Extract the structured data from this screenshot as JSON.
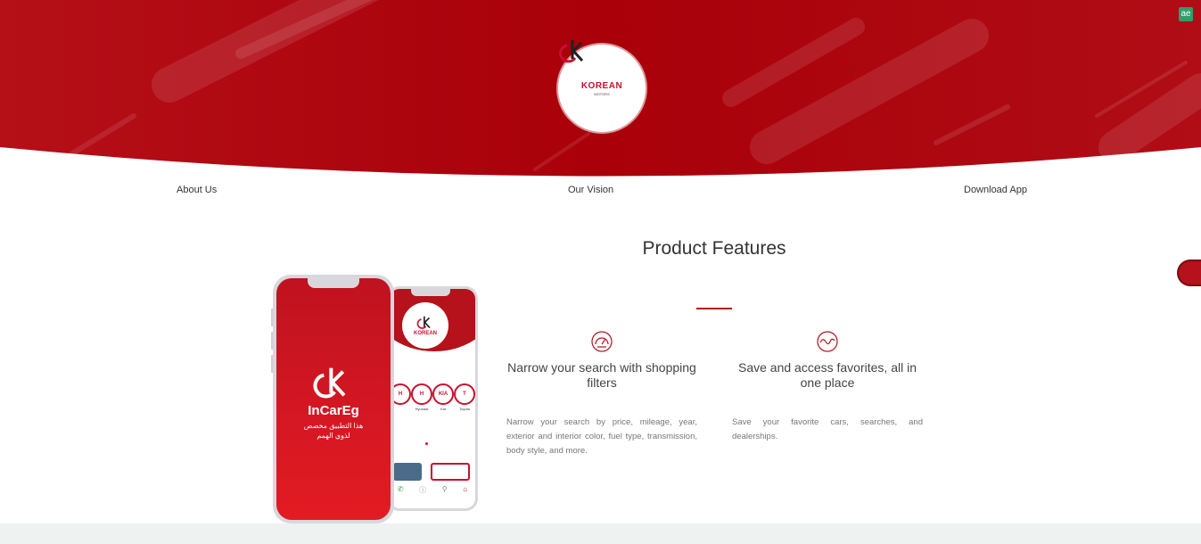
{
  "header": {
    "logo_word": "KOREAN",
    "logo_sub": "MOTORS"
  },
  "nav": {
    "items": [
      "About Us",
      "Our Vision",
      "Download App"
    ]
  },
  "main": {
    "title": "Product Features",
    "features": [
      {
        "icon": "speedometer-icon",
        "heading": "Narrow your search with shopping filters",
        "description": "Narrow your search by price, mileage, year, exterior and interior color, fuel type, transmission, body style, and more."
      },
      {
        "icon": "wave-icon",
        "heading": "Save and access favorites, all in one place",
        "description": "Save your favorite cars, searches, and dealerships."
      }
    ]
  },
  "phone": {
    "app_name": "InCarEg",
    "tagline_line1": "هذا التطبيق مخصص",
    "tagline_line2": "لذوي الهمم",
    "brands": [
      {
        "label": "",
        "logo": "H"
      },
      {
        "label": "Hyundai",
        "logo": "H"
      },
      {
        "label": "Kia",
        "logo": "KIA"
      },
      {
        "label": "Toyota",
        "logo": "T"
      }
    ]
  },
  "badge": {
    "text": "ae"
  },
  "colors": {
    "brand_red": "#b5121b",
    "hero_red": "#b00d16",
    "footer_band": "#eef2f1"
  }
}
